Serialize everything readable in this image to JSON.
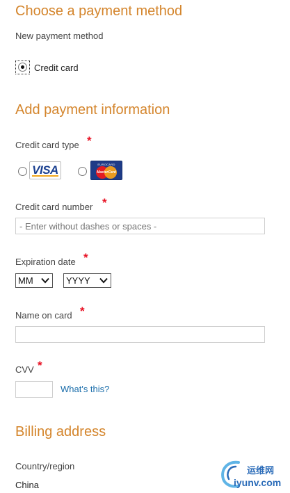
{
  "payment_method": {
    "title": "Choose a payment method",
    "subtitle": "New payment method",
    "option_label": "Credit card",
    "option_selected": true
  },
  "payment_info": {
    "title": "Add payment information",
    "card_type_label": "Credit card type",
    "required_mark": "*",
    "card_types": [
      {
        "name": "VISA",
        "icon": "visa-card-icon",
        "selected": false
      },
      {
        "name": "MasterCard",
        "icon": "mastercard-icon",
        "selected": false
      }
    ],
    "card_number_label": "Credit card number",
    "card_number_placeholder": "- Enter without dashes or spaces -",
    "expiration_label": "Expiration date",
    "month_value": "MM",
    "year_value": "YYYY",
    "name_label": "Name on card",
    "name_value": "",
    "cvv_label": "CVV",
    "cvv_value": "",
    "cvv_help_link": "What's this?"
  },
  "billing": {
    "title": "Billing address",
    "country_label": "Country/region",
    "country_value": "China"
  },
  "watermark": {
    "text_top": "运维网",
    "text_bottom": "iyunv.com"
  },
  "colors": {
    "heading": "#d4852c",
    "required": "#e81123",
    "link": "#1a6daa"
  }
}
